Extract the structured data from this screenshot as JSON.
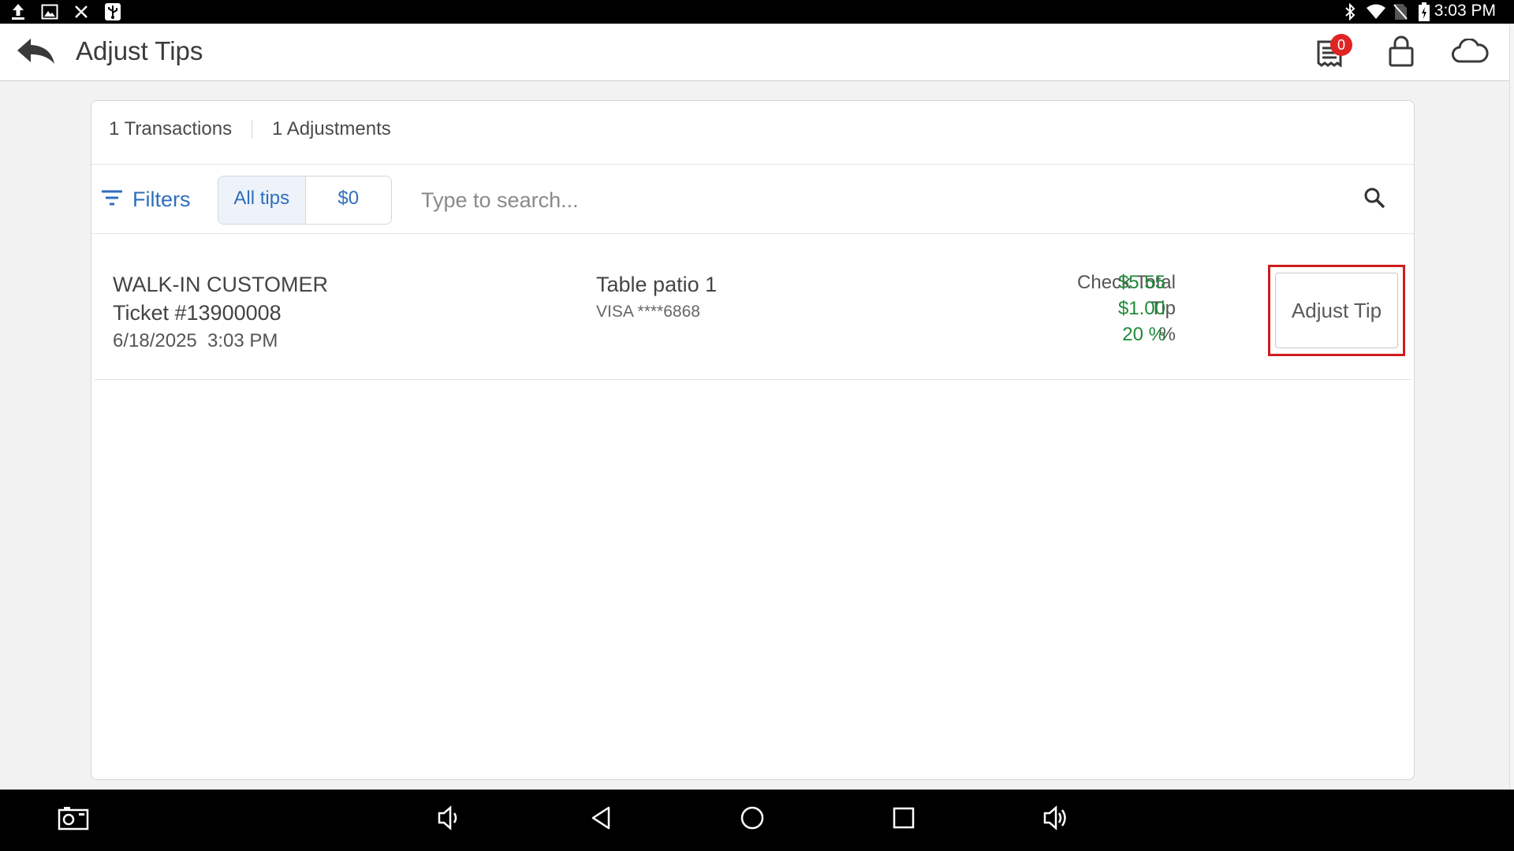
{
  "status_bar": {
    "time": "3:03 PM",
    "left_icons": [
      "upload-icon",
      "image-icon",
      "no-signal-icon",
      "usb-icon"
    ],
    "right_icons": [
      "bluetooth-icon",
      "wifi-icon",
      "no-sim-icon",
      "battery-charging-icon"
    ]
  },
  "header": {
    "title": "Adjust Tips",
    "back_icon": "back-arrow-icon",
    "receipt_badge_count": "0",
    "icons": [
      "receipt-icon",
      "lock-icon",
      "cloud-icon"
    ]
  },
  "summary": {
    "transactions": "1 Transactions",
    "adjustments": "1 Adjustments"
  },
  "filter_bar": {
    "filters_label": "Filters",
    "toggle": [
      "All tips",
      "$0"
    ],
    "selected_toggle": "All tips",
    "search_placeholder": "Type to search..."
  },
  "transactions": [
    {
      "customer": "WALK-IN CUSTOMER",
      "ticket": "Ticket #13900008",
      "date": "6/18/2025",
      "time": "3:03 PM",
      "table": "Table patio 1",
      "card": "VISA ****6868",
      "check_total_label": "Check Total",
      "check_total": "$5.55",
      "tip_label": "Tip",
      "tip": "$1.00",
      "percent_label": "%",
      "percent": "20 %",
      "action_label": "Adjust Tip"
    }
  ],
  "colors": {
    "accent_blue": "#2f6fbd",
    "amount_green": "#1e8a3a",
    "badge_red": "#e02424",
    "highlight_red": "#d01c1c"
  },
  "nav_bar": {
    "icons": [
      "screenshot-icon",
      "volume-down-icon",
      "back-icon",
      "home-icon",
      "recents-icon",
      "volume-up-icon"
    ]
  }
}
